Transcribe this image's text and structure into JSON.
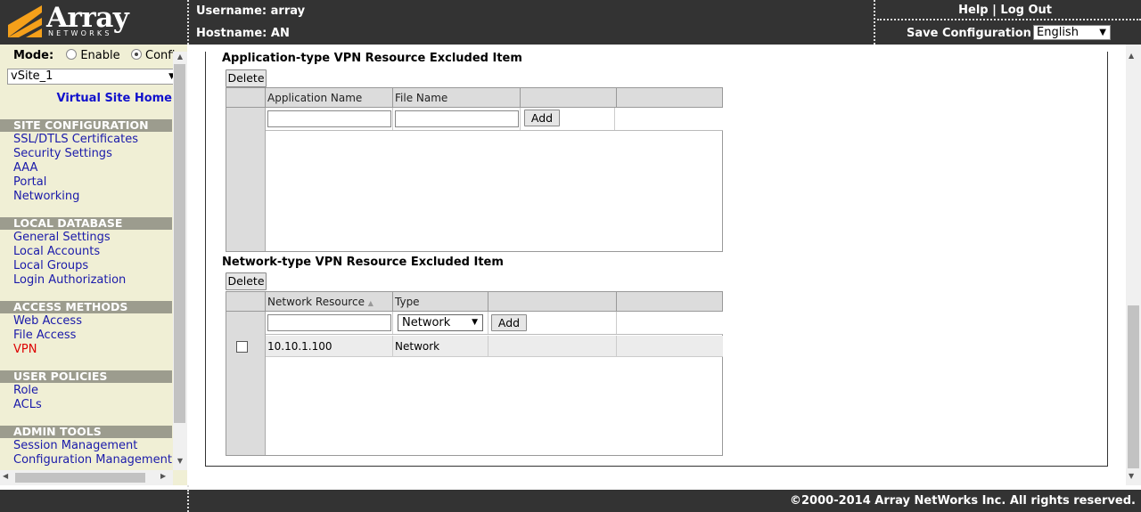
{
  "header": {
    "brand": "Array",
    "brand_sub": "NETWORKS",
    "username": "Username: array",
    "hostname": "Hostname: AN",
    "help": "Help",
    "separator": "|",
    "logout": "Log Out",
    "save_config": "Save Configuration |",
    "language": "English"
  },
  "sidebar": {
    "mode_label": "Mode:",
    "mode_enable": "Enable",
    "mode_config": "Config",
    "vsite": "vSite_1",
    "virtual_site_home": "Virtual Site Home",
    "sections": [
      {
        "title": "SITE CONFIGURATION",
        "items": [
          "SSL/DTLS Certificates",
          "Security Settings",
          "AAA",
          "Portal",
          "Networking"
        ]
      },
      {
        "title": "LOCAL DATABASE",
        "items": [
          "General Settings",
          "Local Accounts",
          "Local Groups",
          "Login Authorization"
        ]
      },
      {
        "title": "ACCESS METHODS",
        "items": [
          "Web Access",
          "File Access",
          "VPN"
        ]
      },
      {
        "title": "USER POLICIES",
        "items": [
          "Role",
          "ACLs"
        ]
      },
      {
        "title": "ADMIN TOOLS",
        "items": [
          "Session Management",
          "Configuration Management"
        ]
      }
    ],
    "active_item": "VPN"
  },
  "app_section": {
    "title": "Application-type VPN Resource Excluded Item",
    "delete_label": "Delete",
    "columns": [
      "Application Name",
      "File Name"
    ],
    "add_label": "Add"
  },
  "net_section": {
    "title": "Network-type VPN Resource Excluded Item",
    "delete_label": "Delete",
    "columns": [
      "Network Resource",
      "Type"
    ],
    "type_value": "Network",
    "add_label": "Add",
    "rows": [
      {
        "resource": "10.10.1.100",
        "type": "Network"
      }
    ]
  },
  "footer": {
    "copyright": "©2000-2014 Array NetWorks Inc. All rights reserved."
  },
  "colors": {
    "chrome": "#333333",
    "sidebar_bg": "#f0efd5",
    "section_head": "#9c9c8e",
    "link": "#1a1aaa",
    "active_link": "#dd0000",
    "logo_orange": "#f5a01a"
  }
}
